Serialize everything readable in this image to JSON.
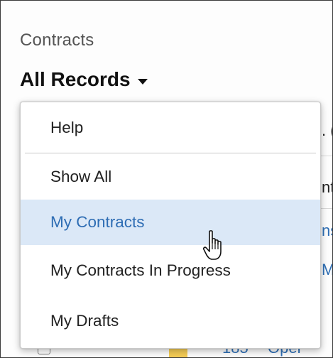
{
  "module": {
    "title": "Contracts"
  },
  "view_selector": {
    "label": "All Records"
  },
  "dropdown": {
    "help": "Help",
    "show_all": "Show All",
    "my_contracts": "My Contracts",
    "my_contracts_in_progress": "My Contracts In Progress",
    "my_drafts": "My Drafts",
    "active_item": "My Contracts",
    "highlight_color": "#dbe8f7",
    "active_text_color": "#2e6db4"
  },
  "background_list": {
    "fragment_1": ". (",
    "fragment_2": "nt",
    "fragment_3": "ns",
    "fragment_4": "M .",
    "row_number": "185",
    "row_word": "Oper"
  },
  "icons": [
    "caret-down-icon",
    "hand-pointer-cursor-icon",
    "checkbox-icon",
    "document-red-icon",
    "folder-yellow-icon"
  ]
}
